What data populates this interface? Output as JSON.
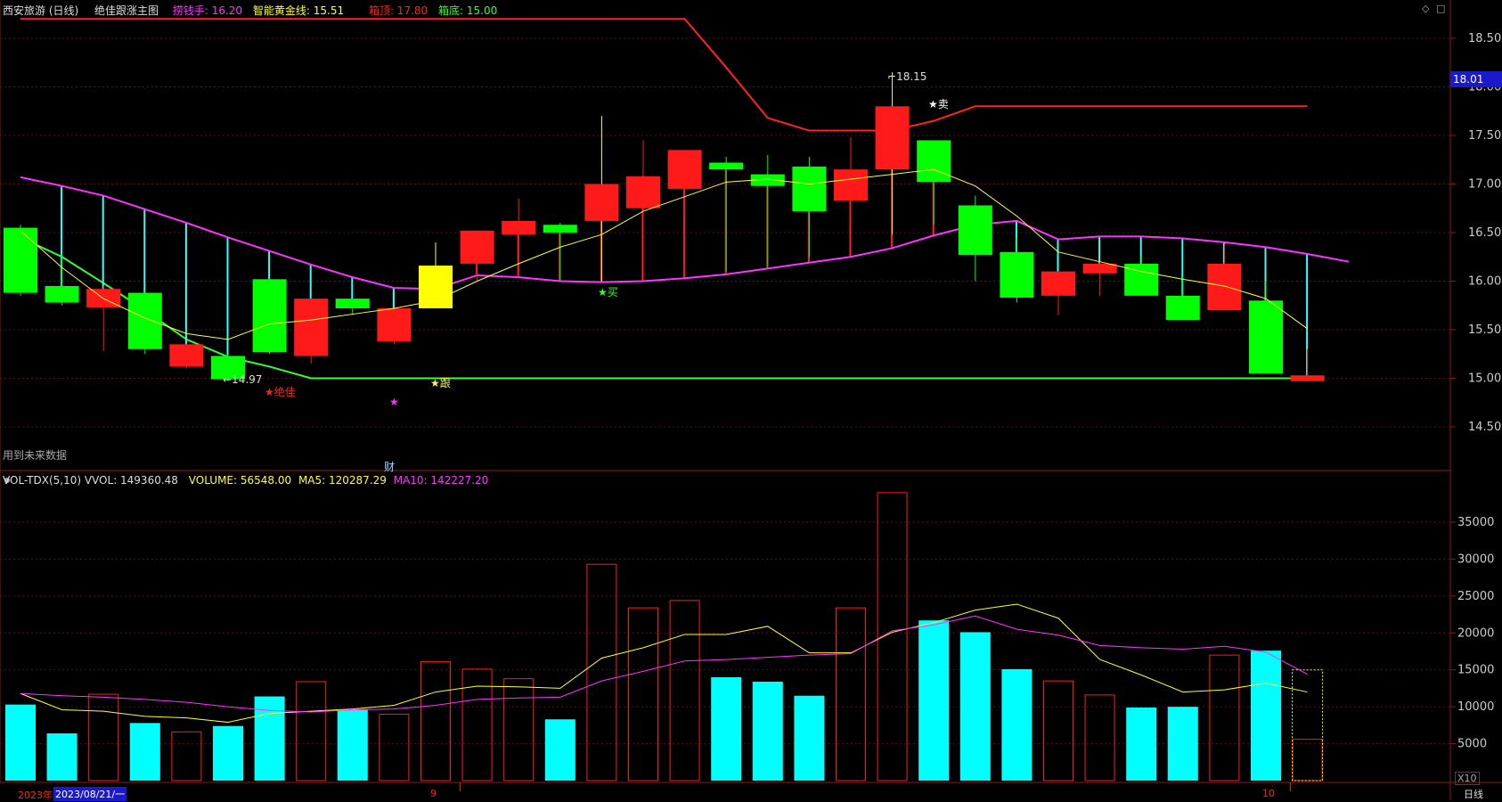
{
  "header": {
    "stock": "西安旅游 (日线)",
    "indicator": "绝佳跟涨主图",
    "fields": [
      {
        "label": "捞钱手: 16.20",
        "color": "#ff33ff"
      },
      {
        "label": "智能黄金线: 15.51",
        "color": "#ffff33"
      },
      {
        "label": "箱顶: 17.80",
        "color": "#ff2222"
      },
      {
        "label": "箱底: 15.00",
        "color": "#33ff33"
      }
    ],
    "corner_icons": [
      "◇",
      "□"
    ]
  },
  "main_axis": {
    "ticks": [
      "18.50",
      "18.00",
      "17.50",
      "17.00",
      "16.50",
      "16.00",
      "15.50",
      "15.00",
      "14.50"
    ],
    "values": [
      18.5,
      18.0,
      17.5,
      17.0,
      16.5,
      16.0,
      15.5,
      15.0,
      14.5
    ]
  },
  "price_tag": "18.01",
  "annotations": {
    "high_label": "18.15",
    "low_label": "←14.97",
    "juejia": "★绝佳",
    "gen": "★跟",
    "mai_buy": "★买",
    "mai_sell": "★卖",
    "star": "★",
    "future_data": "用到未来数据",
    "cai": "财"
  },
  "volume_panel": {
    "header_main": "VOL-TDX(5,10) VVOL: 149360.48",
    "volume": "VOLUME: 56548.00",
    "ma5": "MA5: 120287.29",
    "ma10": "MA10: 142227.20",
    "ticks": [
      "35000",
      "30000",
      "25000",
      "20000",
      "15000",
      "10000",
      "5000"
    ],
    "tick_values": [
      35000,
      30000,
      25000,
      20000,
      15000,
      10000,
      5000
    ],
    "x10": "X10"
  },
  "bottom_axis": {
    "year": "2023年",
    "date_cursor": "2023/08/21/一",
    "sep": "9",
    "oct": "10",
    "period": "日线"
  },
  "colors": {
    "up": "#ff1a1a",
    "down": "#00ff00",
    "vol_down": "#00ffff",
    "magenta": "#ff33ff",
    "yellow": "#ffff33",
    "red": "#ff2222",
    "green": "#33ff33",
    "cyan": "#33ffff"
  },
  "candles": [
    {
      "o": 16.55,
      "h": 16.58,
      "l": 15.85,
      "c": 15.88
    },
    {
      "o": 15.95,
      "h": 16.28,
      "l": 15.75,
      "c": 15.78
    },
    {
      "o": 15.73,
      "h": 15.95,
      "l": 15.28,
      "c": 15.92
    },
    {
      "o": 15.88,
      "h": 15.9,
      "l": 15.25,
      "c": 15.3
    },
    {
      "o": 15.12,
      "h": 15.35,
      "l": 15.1,
      "c": 15.35
    },
    {
      "o": 15.23,
      "h": 15.25,
      "l": 14.97,
      "c": 14.99
    },
    {
      "o": 16.02,
      "h": 16.03,
      "l": 15.25,
      "c": 15.27
    },
    {
      "o": 15.23,
      "h": 15.8,
      "l": 15.15,
      "c": 15.82
    },
    {
      "o": 15.82,
      "h": 15.82,
      "l": 15.65,
      "c": 15.72
    },
    {
      "o": 15.38,
      "h": 15.72,
      "l": 15.35,
      "c": 15.72
    },
    {
      "o": 15.72,
      "h": 16.4,
      "l": 15.72,
      "c": 16.16
    },
    {
      "o": 16.18,
      "h": 16.5,
      "l": 16.0,
      "c": 16.52
    },
    {
      "o": 16.48,
      "h": 16.85,
      "l": 16.05,
      "c": 16.62
    },
    {
      "o": 16.58,
      "h": 16.6,
      "l": 16.0,
      "c": 16.5
    },
    {
      "o": 16.62,
      "h": 17.7,
      "l": 16.0,
      "c": 17.0
    },
    {
      "o": 16.75,
      "h": 17.45,
      "l": 16.0,
      "c": 17.08
    },
    {
      "o": 16.95,
      "h": 17.35,
      "l": 16.05,
      "c": 17.35
    },
    {
      "o": 17.22,
      "h": 17.28,
      "l": 16.1,
      "c": 17.15
    },
    {
      "o": 17.1,
      "h": 17.3,
      "l": 16.15,
      "c": 16.98
    },
    {
      "o": 17.18,
      "h": 17.28,
      "l": 16.25,
      "c": 16.72
    },
    {
      "o": 16.83,
      "h": 17.48,
      "l": 16.35,
      "c": 17.15
    },
    {
      "o": 17.15,
      "h": 18.15,
      "l": 16.48,
      "c": 17.8
    },
    {
      "o": 17.45,
      "h": 17.45,
      "l": 16.58,
      "c": 17.02
    },
    {
      "o": 16.78,
      "h": 16.88,
      "l": 16.0,
      "c": 16.27
    },
    {
      "o": 16.3,
      "h": 16.45,
      "l": 15.78,
      "c": 15.83
    },
    {
      "o": 15.85,
      "h": 16.1,
      "l": 15.65,
      "c": 16.1
    },
    {
      "o": 16.08,
      "h": 16.2,
      "l": 15.85,
      "c": 16.18
    },
    {
      "o": 16.18,
      "h": 16.25,
      "l": 15.85,
      "c": 15.85
    },
    {
      "o": 15.85,
      "h": 16.05,
      "l": 15.6,
      "c": 15.6
    },
    {
      "o": 15.7,
      "h": 16.38,
      "l": 15.7,
      "c": 16.18
    },
    {
      "o": 15.8,
      "h": 16.0,
      "l": 15.05,
      "c": 15.05
    },
    {
      "o": 14.97,
      "h": 15.3,
      "l": 14.97,
      "c": 15.03
    }
  ],
  "upper_line": [
    17.07,
    16.98,
    16.88,
    16.74,
    16.6,
    16.45,
    16.31,
    16.17,
    16.04,
    15.93,
    15.92,
    16.06,
    16.04,
    16.0,
    15.99,
    16.0,
    16.03,
    16.07,
    16.13,
    16.19,
    16.25,
    16.34,
    16.47,
    16.58,
    16.62,
    16.43,
    16.46,
    16.46,
    16.44,
    16.4,
    16.35,
    16.28,
    16.2
  ],
  "yellow_line": [
    16.52,
    16.14,
    15.82,
    15.62,
    15.46,
    15.4,
    15.56,
    15.6,
    15.66,
    15.72,
    15.8,
    16.0,
    16.18,
    16.35,
    16.48,
    16.72,
    16.87,
    17.02,
    17.05,
    17.0,
    17.05,
    17.1,
    17.15,
    16.98,
    16.67,
    16.3,
    16.2,
    16.1,
    16.02,
    15.95,
    15.82,
    15.51
  ],
  "green_line": [
    16.45,
    16.25,
    15.98,
    15.7,
    15.4,
    15.22,
    15.12,
    15.0
  ],
  "red_line": [
    [
      0,
      18.7
    ],
    [
      16,
      18.7
    ],
    [
      17,
      18.2
    ],
    [
      18,
      17.68
    ],
    [
      19,
      17.55
    ],
    [
      20,
      17.55
    ],
    [
      21,
      17.55
    ],
    [
      22,
      17.65
    ],
    [
      23,
      17.8
    ],
    [
      31,
      17.8
    ]
  ],
  "volume": [
    {
      "v": 10300,
      "up": false
    },
    {
      "v": 6400,
      "up": false
    },
    {
      "v": 11700,
      "up": true
    },
    {
      "v": 7800,
      "up": false
    },
    {
      "v": 6600,
      "up": true
    },
    {
      "v": 7400,
      "up": false
    },
    {
      "v": 11400,
      "up": false
    },
    {
      "v": 13400,
      "up": true
    },
    {
      "v": 9600,
      "up": false
    },
    {
      "v": 9000,
      "up": true
    },
    {
      "v": 16100,
      "up": true
    },
    {
      "v": 15100,
      "up": true
    },
    {
      "v": 13800,
      "up": true
    },
    {
      "v": 8300,
      "up": false
    },
    {
      "v": 29300,
      "up": true
    },
    {
      "v": 23400,
      "up": true
    },
    {
      "v": 24400,
      "up": true
    },
    {
      "v": 14000,
      "up": false
    },
    {
      "v": 13400,
      "up": false
    },
    {
      "v": 11500,
      "up": false
    },
    {
      "v": 23400,
      "up": true
    },
    {
      "v": 39000,
      "up": true
    },
    {
      "v": 21700,
      "up": false
    },
    {
      "v": 20100,
      "up": false
    },
    {
      "v": 15100,
      "up": false
    },
    {
      "v": 13500,
      "up": true
    },
    {
      "v": 11600,
      "up": true
    },
    {
      "v": 9900,
      "up": false
    },
    {
      "v": 10000,
      "up": false
    },
    {
      "v": 17000,
      "up": true
    },
    {
      "v": 17600,
      "up": false
    },
    {
      "v": 5600,
      "up": true
    }
  ],
  "ma5": [
    11800,
    9600,
    9400,
    8700,
    8500,
    7900,
    9100,
    9400,
    9700,
    10200,
    12000,
    12800,
    12700,
    12500,
    16600,
    18000,
    19800,
    19800,
    20900,
    17300,
    17300,
    20100,
    21400,
    23100,
    23900,
    22000,
    16400,
    14300,
    12000,
    12300,
    13200,
    12000
  ],
  "ma10": [
    11800,
    11500,
    11300,
    11000,
    10600,
    10000,
    9500,
    9300,
    9600,
    9700,
    10200,
    11000,
    11200,
    11300,
    13500,
    14800,
    16200,
    16400,
    16700,
    17000,
    17200,
    20300,
    21100,
    22300,
    20500,
    19700,
    18300,
    18000,
    17800,
    18200,
    17400,
    14400
  ]
}
